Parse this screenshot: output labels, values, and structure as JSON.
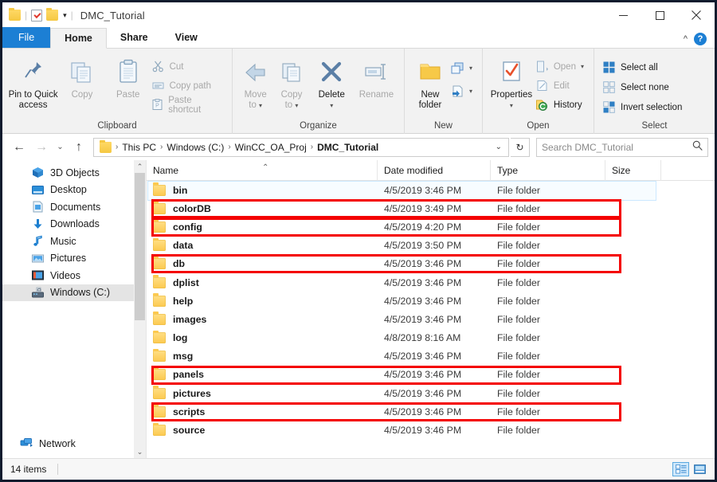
{
  "window": {
    "title": "DMC_Tutorial",
    "minimize_label": "Minimize",
    "maximize_label": "Maximize",
    "close_label": "Close"
  },
  "quick_access": {
    "properties_icon": "folder-icon",
    "check_icon": "properties-check-icon",
    "new_folder_icon": "new-folder-icon",
    "customize_caret": "▾"
  },
  "tabs": [
    {
      "label": "File",
      "id": "file"
    },
    {
      "label": "Home",
      "id": "home"
    },
    {
      "label": "Share",
      "id": "share"
    },
    {
      "label": "View",
      "id": "view"
    }
  ],
  "ribbon": {
    "collapse_caret": "^",
    "help_label": "?",
    "groups": [
      {
        "label": "Clipboard",
        "big": [
          {
            "label_line1": "Pin to Quick",
            "label_line2": "access",
            "icon": "pin-icon",
            "dim": false
          },
          {
            "label_line1": "Copy",
            "label_line2": "",
            "icon": "copy-icon",
            "dim": true
          },
          {
            "label_line1": "Paste",
            "label_line2": "",
            "icon": "paste-icon",
            "dim": true
          }
        ],
        "small": [
          {
            "label": "Cut",
            "icon": "scissors-icon",
            "dim": true
          },
          {
            "label": "Copy path",
            "icon": "copy-path-icon",
            "dim": true
          },
          {
            "label": "Paste shortcut",
            "icon": "paste-shortcut-icon",
            "dim": true
          }
        ]
      },
      {
        "label": "Organize",
        "big": [
          {
            "label_line1": "Move",
            "label_line2": "to",
            "icon": "move-to-icon",
            "dim": true,
            "caret": "▾"
          },
          {
            "label_line1": "Copy",
            "label_line2": "to",
            "icon": "copy-to-icon",
            "dim": true,
            "caret": "▾"
          },
          {
            "label_line1": "Delete",
            "label_line2": "",
            "icon": "delete-x-icon",
            "dim": false,
            "caret": "▾"
          },
          {
            "label_line1": "Rename",
            "label_line2": "",
            "icon": "rename-icon",
            "dim": true
          }
        ],
        "small": []
      },
      {
        "label": "New",
        "big": [
          {
            "label_line1": "New",
            "label_line2": "folder",
            "icon": "new-folder-icon",
            "dim": false
          }
        ],
        "small": [
          {
            "label": "",
            "icon": "new-item-icon",
            "dim": false,
            "caret": "▾"
          },
          {
            "label": "",
            "icon": "easy-access-icon",
            "dim": false,
            "caret": "▾"
          }
        ]
      },
      {
        "label": "Open",
        "big": [
          {
            "label_line1": "Properties",
            "label_line2": "",
            "icon": "properties-icon",
            "dim": false,
            "caret": "▾"
          }
        ],
        "small": [
          {
            "label": "Open",
            "icon": "open-icon",
            "dim": true,
            "caret": "▾"
          },
          {
            "label": "Edit",
            "icon": "edit-icon",
            "dim": true
          },
          {
            "label": "History",
            "icon": "history-icon",
            "dim": false
          }
        ]
      },
      {
        "label": "Select",
        "big": [],
        "small": [
          {
            "label": "Select all",
            "icon": "select-all-icon",
            "dim": false
          },
          {
            "label": "Select none",
            "icon": "select-none-icon",
            "dim": false
          },
          {
            "label": "Invert selection",
            "icon": "invert-selection-icon",
            "dim": false
          }
        ]
      }
    ]
  },
  "address": {
    "back_label": "Back",
    "forward_label": "Forward",
    "recent_label": "Recent locations",
    "up_label": "Up",
    "crumbs": [
      "This PC",
      "Windows (C:)",
      "WinCC_OA_Proj",
      "DMC_Tutorial"
    ],
    "separator": "›",
    "dropdown_caret": "⌄",
    "refresh_glyph": "↻"
  },
  "search": {
    "placeholder": "Search DMC_Tutorial",
    "icon": "search-icon"
  },
  "navpane": {
    "items": [
      {
        "label": "3D Objects",
        "icon": "3d-objects-icon",
        "selected": false
      },
      {
        "label": "Desktop",
        "icon": "desktop-icon",
        "selected": false
      },
      {
        "label": "Documents",
        "icon": "documents-icon",
        "selected": false
      },
      {
        "label": "Downloads",
        "icon": "downloads-icon",
        "selected": false
      },
      {
        "label": "Music",
        "icon": "music-icon",
        "selected": false
      },
      {
        "label": "Pictures",
        "icon": "pictures-icon",
        "selected": false
      },
      {
        "label": "Videos",
        "icon": "videos-icon",
        "selected": false
      },
      {
        "label": "Windows (C:)",
        "icon": "drive-icon",
        "selected": true
      }
    ],
    "network": {
      "label": "Network",
      "icon": "network-icon"
    },
    "scroll_up": "⌃",
    "scroll_down": "⌄"
  },
  "filelist": {
    "columns": [
      {
        "label": "Name",
        "key": "name",
        "sorted": true,
        "sort_glyph": "⌃"
      },
      {
        "label": "Date modified",
        "key": "date"
      },
      {
        "label": "Type",
        "key": "type"
      },
      {
        "label": "Size",
        "key": "size"
      }
    ],
    "rows": [
      {
        "name": "bin",
        "date": "4/5/2019 3:46 PM",
        "type": "File folder",
        "size": "",
        "selected": true,
        "highlighted": false
      },
      {
        "name": "colorDB",
        "date": "4/5/2019 3:49 PM",
        "type": "File folder",
        "size": "",
        "selected": false,
        "highlighted": true
      },
      {
        "name": "config",
        "date": "4/5/2019 4:20 PM",
        "type": "File folder",
        "size": "",
        "selected": false,
        "highlighted": true
      },
      {
        "name": "data",
        "date": "4/5/2019 3:50 PM",
        "type": "File folder",
        "size": "",
        "selected": false,
        "highlighted": false
      },
      {
        "name": "db",
        "date": "4/5/2019 3:46 PM",
        "type": "File folder",
        "size": "",
        "selected": false,
        "highlighted": true
      },
      {
        "name": "dplist",
        "date": "4/5/2019 3:46 PM",
        "type": "File folder",
        "size": "",
        "selected": false,
        "highlighted": false
      },
      {
        "name": "help",
        "date": "4/5/2019 3:46 PM",
        "type": "File folder",
        "size": "",
        "selected": false,
        "highlighted": false
      },
      {
        "name": "images",
        "date": "4/5/2019 3:46 PM",
        "type": "File folder",
        "size": "",
        "selected": false,
        "highlighted": false
      },
      {
        "name": "log",
        "date": "4/8/2019 8:16 AM",
        "type": "File folder",
        "size": "",
        "selected": false,
        "highlighted": false
      },
      {
        "name": "msg",
        "date": "4/5/2019 3:46 PM",
        "type": "File folder",
        "size": "",
        "selected": false,
        "highlighted": false
      },
      {
        "name": "panels",
        "date": "4/5/2019 3:46 PM",
        "type": "File folder",
        "size": "",
        "selected": false,
        "highlighted": true
      },
      {
        "name": "pictures",
        "date": "4/5/2019 3:46 PM",
        "type": "File folder",
        "size": "",
        "selected": false,
        "highlighted": false
      },
      {
        "name": "scripts",
        "date": "4/5/2019 3:46 PM",
        "type": "File folder",
        "size": "",
        "selected": false,
        "highlighted": true
      },
      {
        "name": "source",
        "date": "4/5/2019 3:46 PM",
        "type": "File folder",
        "size": "",
        "selected": false,
        "highlighted": false
      }
    ]
  },
  "statusbar": {
    "item_count": "14 items",
    "details_view_label": "Details view",
    "large_icons_view_label": "Large icons view"
  },
  "colors": {
    "accent": "#1c7fd4",
    "highlight_red": "#f40000",
    "folder_yellow": "#fcc94f",
    "selection_blue": "#cce8ff",
    "ribbon_bg": "#f2f2f2"
  }
}
